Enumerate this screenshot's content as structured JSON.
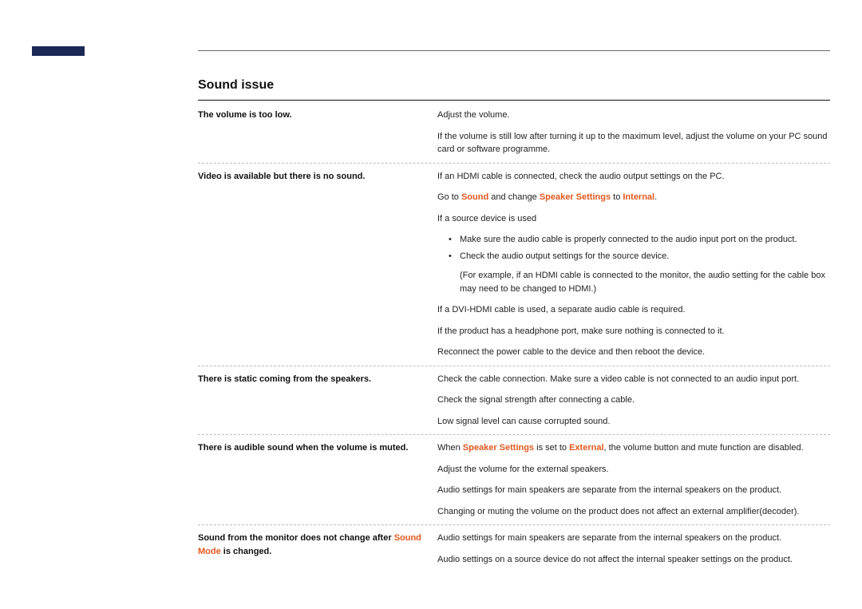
{
  "section_title": "Sound issue",
  "rows": [
    {
      "issue": "The volume is too low.",
      "paras": [
        {
          "type": "p",
          "text": "Adjust the volume."
        },
        {
          "type": "p",
          "text": "If the volume is still low after turning it up to the maximum level, adjust the volume on your PC sound card or software programme."
        }
      ]
    },
    {
      "issue": "Video is available but there is no sound.",
      "paras": [
        {
          "type": "p",
          "text": "If an HDMI cable is connected, check the audio output settings on the PC."
        },
        {
          "type": "rich",
          "parts": [
            {
              "t": "Go to "
            },
            {
              "t": "Sound",
              "accent": true
            },
            {
              "t": " and change "
            },
            {
              "t": "Speaker Settings",
              "accent": true
            },
            {
              "t": " to "
            },
            {
              "t": "Internal",
              "accent": true
            },
            {
              "t": "."
            }
          ]
        },
        {
          "type": "p",
          "text": "If a source device is used"
        },
        {
          "type": "ul",
          "items": [
            "Make sure the audio cable is properly connected to the audio input port on the product.",
            "Check the audio output settings for the source device."
          ]
        },
        {
          "type": "sub",
          "text": "(For example, if an HDMI cable is connected to the monitor, the audio setting for the cable box may need to be changed to HDMI.)"
        },
        {
          "type": "p",
          "text": "If a DVI-HDMI cable is used, a separate audio cable is required."
        },
        {
          "type": "p",
          "text": "If the product has a headphone port, make sure nothing is connected to it."
        },
        {
          "type": "p",
          "text": "Reconnect the power cable to the device and then reboot the device."
        }
      ]
    },
    {
      "issue": "There is static coming from the speakers.",
      "paras": [
        {
          "type": "p",
          "text": "Check the cable connection. Make sure a video cable is not connected to an audio input port."
        },
        {
          "type": "p",
          "text": "Check the signal strength after connecting a cable."
        },
        {
          "type": "p",
          "text": "Low signal level can cause corrupted sound."
        }
      ]
    },
    {
      "issue": "There is audible sound when the volume is muted.",
      "paras": [
        {
          "type": "rich",
          "parts": [
            {
              "t": "When "
            },
            {
              "t": "Speaker Settings",
              "accent": true
            },
            {
              "t": " is set to "
            },
            {
              "t": "External",
              "accent": true
            },
            {
              "t": ", the volume button and mute function are disabled."
            }
          ]
        },
        {
          "type": "p",
          "text": "Adjust the volume for the external speakers."
        },
        {
          "type": "p",
          "text": "Audio settings for main speakers are separate from the internal speakers on the product."
        },
        {
          "type": "p",
          "text": "Changing or muting the volume on the product does not affect an external amplifier(decoder)."
        }
      ]
    },
    {
      "issue_rich": [
        {
          "t": "Sound from the monitor does not change after "
        },
        {
          "t": "Sound Mode",
          "accent": true
        },
        {
          "t": " is changed."
        }
      ],
      "paras": [
        {
          "type": "p",
          "text": "Audio settings for main speakers are separate from the internal speakers on the product."
        },
        {
          "type": "p",
          "text": "Audio settings on a source device do not affect the internal speaker settings on the product."
        }
      ]
    }
  ]
}
